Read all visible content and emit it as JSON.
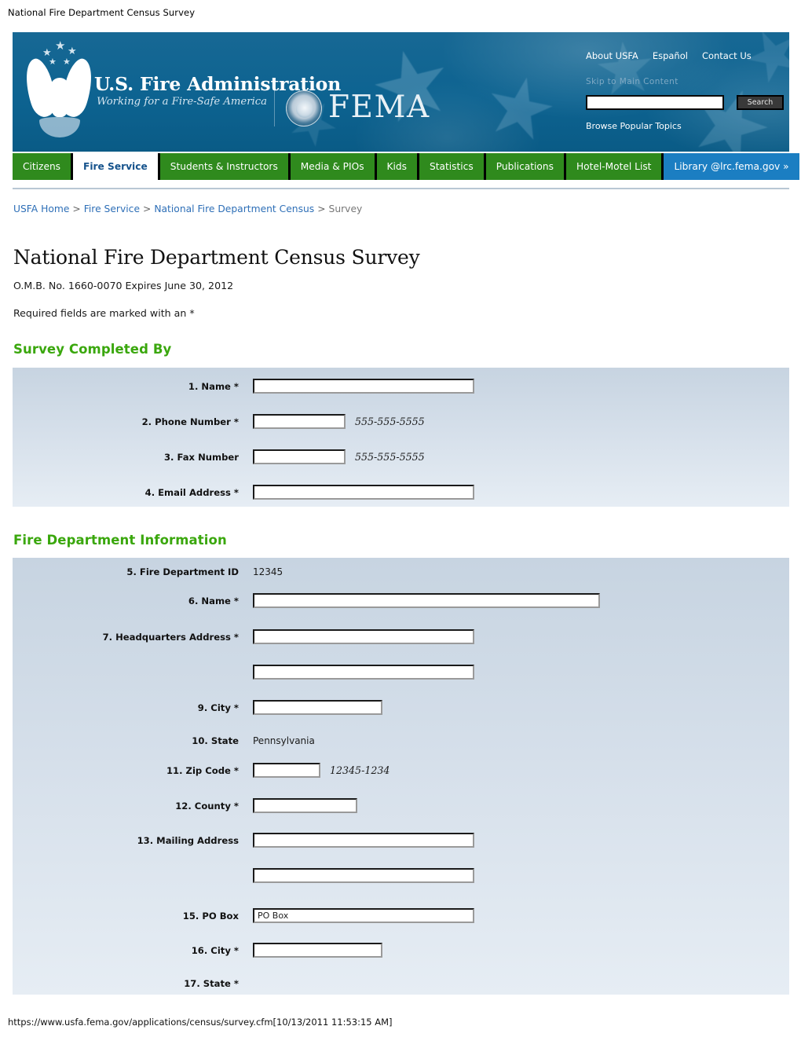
{
  "document": {
    "print_title": "National Fire Department Census Survey",
    "footer_url": "https://www.usfa.fema.gov/applications/census/survey.cfm[10/13/2011 11:53:15 AM]"
  },
  "masthead": {
    "logo_line1": "U.S. Fire Administration",
    "logo_line2": "Working for a Fire-Safe America",
    "fema_wordmark": "FEMA",
    "util_links": [
      {
        "label": "About USFA"
      },
      {
        "label": "Español"
      },
      {
        "label": "Contact Us"
      }
    ],
    "skip_link": "Skip to Main Content",
    "search": {
      "value": "",
      "placeholder": "",
      "button_label": "Search"
    },
    "browse_link": "Browse Popular Topics",
    "colors": {
      "banner_blue": "#0d6391",
      "nav_green": "#2f8a1d",
      "library_blue": "#1b7ec2"
    }
  },
  "nav": {
    "tabs": [
      {
        "label": "Citizens",
        "active": false
      },
      {
        "label": "Fire Service",
        "active": true
      },
      {
        "label": "Students & Instructors",
        "active": false
      },
      {
        "label": "Media & PIOs",
        "active": false
      },
      {
        "label": "Kids",
        "active": false
      },
      {
        "label": "Statistics",
        "active": false
      },
      {
        "label": "Publications",
        "active": false
      },
      {
        "label": "Hotel-Motel List",
        "active": false
      },
      {
        "label": "Library @lrc.fema.gov »",
        "active": false
      }
    ]
  },
  "breadcrumb": {
    "items": [
      {
        "label": "USFA Home",
        "link": true
      },
      {
        "label": "Fire Service",
        "link": true
      },
      {
        "label": "National Fire Department Census",
        "link": true
      },
      {
        "label": "Survey",
        "link": false
      }
    ],
    "separator": ">"
  },
  "content": {
    "title": "National Fire Department Census Survey",
    "omb": "O.M.B. No. 1660-0070 Expires June 30, 2012",
    "required_note": "Required fields are marked with an *"
  },
  "sections": [
    {
      "heading": "Survey Completed By",
      "fields": [
        {
          "label": "1. Name *",
          "type": "text",
          "value": "",
          "hint": ""
        },
        {
          "label": "2. Phone Number *",
          "type": "text",
          "value": "",
          "hint": "555-555-5555"
        },
        {
          "label": "3. Fax Number",
          "type": "text",
          "value": "",
          "hint": "555-555-5555"
        },
        {
          "label": "4. Email Address *",
          "type": "text",
          "value": "",
          "hint": ""
        }
      ]
    },
    {
      "heading": "Fire Department Information",
      "fields": [
        {
          "label": "5. Fire Department ID",
          "type": "static",
          "value": "12345",
          "hint": ""
        },
        {
          "label": "6. Name *",
          "type": "text",
          "value": "",
          "hint": ""
        },
        {
          "label": "7. Headquarters Address *",
          "type": "text",
          "value": "",
          "hint": ""
        },
        {
          "label": "",
          "type": "text",
          "value": "",
          "hint": ""
        },
        {
          "label": "9. City *",
          "type": "text",
          "value": "",
          "hint": ""
        },
        {
          "label": "10. State",
          "type": "static",
          "value": "Pennsylvania",
          "hint": ""
        },
        {
          "label": "11. Zip Code *",
          "type": "text",
          "value": "",
          "hint": "12345-1234"
        },
        {
          "label": "12. County *",
          "type": "text",
          "value": "",
          "hint": ""
        },
        {
          "label": "13. Mailing Address",
          "type": "text",
          "value": "",
          "hint": ""
        },
        {
          "label": "",
          "type": "text",
          "value": "",
          "hint": ""
        },
        {
          "label": "15. PO Box",
          "type": "text",
          "value": "PO Box",
          "hint": ""
        },
        {
          "label": "16. City *",
          "type": "text",
          "value": "",
          "hint": ""
        },
        {
          "label": "17. State *",
          "type": "none",
          "value": "",
          "hint": ""
        }
      ]
    }
  ]
}
